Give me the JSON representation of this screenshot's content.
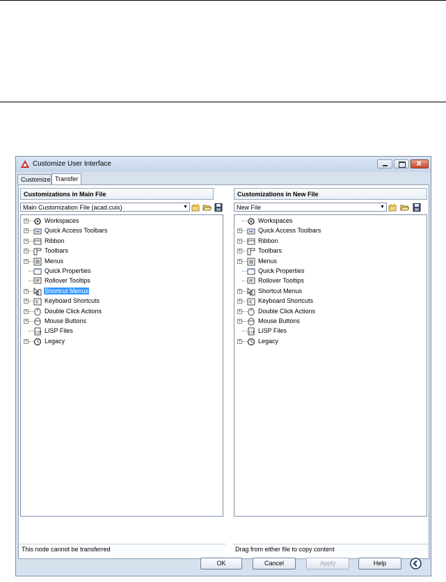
{
  "window": {
    "title": "Customize User Interface",
    "controls": {
      "minimize": "minimize-icon",
      "maximize": "maximize-icon",
      "close": "close-icon"
    }
  },
  "tabs": [
    {
      "label": "Customize",
      "active": false
    },
    {
      "label": "Transfer",
      "active": true
    }
  ],
  "left": {
    "header": "Customizations in Main File",
    "file_select": "Main Customization File (acad.cuix)",
    "status": "This node cannot be transferred",
    "nodes": [
      {
        "label": "Workspaces",
        "expandable": true,
        "icon": "workspaces-icon",
        "selected": false
      },
      {
        "label": "Quick Access Toolbars",
        "expandable": true,
        "icon": "qat-icon",
        "selected": false
      },
      {
        "label": "Ribbon",
        "expandable": true,
        "icon": "ribbon-icon",
        "selected": false
      },
      {
        "label": "Toolbars",
        "expandable": true,
        "icon": "toolbars-icon",
        "selected": false
      },
      {
        "label": "Menus",
        "expandable": true,
        "icon": "menus-icon",
        "selected": false
      },
      {
        "label": "Quick Properties",
        "expandable": false,
        "icon": "quick-properties-icon",
        "selected": false
      },
      {
        "label": "Rollover Tooltips",
        "expandable": false,
        "icon": "rollover-tooltips-icon",
        "selected": false
      },
      {
        "label": "Shortcut Menus",
        "expandable": true,
        "icon": "shortcut-menus-icon",
        "selected": true
      },
      {
        "label": "Keyboard Shortcuts",
        "expandable": true,
        "icon": "keyboard-shortcuts-icon",
        "selected": false
      },
      {
        "label": "Double Click Actions",
        "expandable": true,
        "icon": "double-click-icon",
        "selected": false
      },
      {
        "label": "Mouse Buttons",
        "expandable": true,
        "icon": "mouse-buttons-icon",
        "selected": false
      },
      {
        "label": "LISP Files",
        "expandable": false,
        "icon": "lisp-files-icon",
        "selected": false
      },
      {
        "label": "Legacy",
        "expandable": true,
        "icon": "legacy-icon",
        "selected": false
      }
    ]
  },
  "right": {
    "header": "Customizations in New File",
    "file_select": "New File",
    "status": "Drag from either file to copy content",
    "nodes": [
      {
        "label": "Workspaces",
        "expandable": false,
        "icon": "workspaces-icon",
        "selected": false
      },
      {
        "label": "Quick Access Toolbars",
        "expandable": true,
        "icon": "qat-icon",
        "selected": false
      },
      {
        "label": "Ribbon",
        "expandable": true,
        "icon": "ribbon-icon",
        "selected": false
      },
      {
        "label": "Toolbars",
        "expandable": true,
        "icon": "toolbars-icon",
        "selected": false
      },
      {
        "label": "Menus",
        "expandable": true,
        "icon": "menus-icon",
        "selected": false
      },
      {
        "label": "Quick Properties",
        "expandable": false,
        "icon": "quick-properties-icon",
        "selected": false
      },
      {
        "label": "Rollover Tooltips",
        "expandable": false,
        "icon": "rollover-tooltips-icon",
        "selected": false
      },
      {
        "label": "Shortcut Menus",
        "expandable": true,
        "icon": "shortcut-menus-icon",
        "selected": false
      },
      {
        "label": "Keyboard Shortcuts",
        "expandable": true,
        "icon": "keyboard-shortcuts-icon",
        "selected": false
      },
      {
        "label": "Double Click Actions",
        "expandable": true,
        "icon": "double-click-icon",
        "selected": false
      },
      {
        "label": "Mouse Buttons",
        "expandable": true,
        "icon": "mouse-buttons-icon",
        "selected": false
      },
      {
        "label": "LISP Files",
        "expandable": false,
        "icon": "lisp-files-icon",
        "selected": false
      },
      {
        "label": "Legacy",
        "expandable": true,
        "icon": "legacy-icon",
        "selected": false
      }
    ]
  },
  "buttons": {
    "ok": "OK",
    "cancel": "Cancel",
    "apply": "Apply",
    "help": "Help"
  },
  "colors": {
    "selection": "#3399ff",
    "window_bg": "#d7e1ee",
    "close_button": "#c7462c"
  }
}
